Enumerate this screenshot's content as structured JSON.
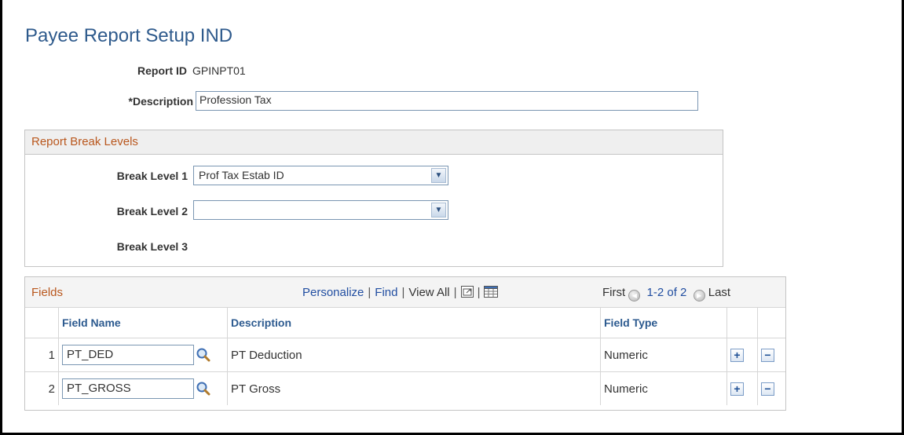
{
  "page": {
    "title": "Payee Report Setup IND"
  },
  "report": {
    "id_label": "Report ID",
    "id_value": "GPINPT01",
    "description_label": "*Description",
    "description_value": "Profession Tax"
  },
  "break_levels": {
    "title": "Report Break Levels",
    "level1_label": "Break Level 1",
    "level1_value": "Prof Tax Estab ID",
    "level2_label": "Break Level 2",
    "level2_value": "",
    "level3_label": "Break Level 3"
  },
  "fields_grid": {
    "title": "Fields",
    "nav": {
      "personalize": "Personalize",
      "find": "Find",
      "view_all": "View All",
      "sep": "|",
      "first": "First",
      "count": "1-2 of 2",
      "last": "Last"
    },
    "columns": {
      "field_name": "Field Name",
      "description": "Description",
      "field_type": "Field Type"
    },
    "rows": [
      {
        "num": "1",
        "field_name": "PT_DED",
        "description": "PT Deduction",
        "field_type": "Numeric"
      },
      {
        "num": "2",
        "field_name": "PT_GROSS",
        "description": "PT Gross",
        "field_type": "Numeric"
      }
    ],
    "add_symbol": "+",
    "delete_symbol": "−"
  },
  "icons": {
    "lookup": "magnifier-icon",
    "zoom": "new-window-icon",
    "download": "spreadsheet-icon",
    "prev": "left-arrow-icon",
    "next": "right-arrow-icon"
  },
  "colors": {
    "title_blue": "#2e5a8c",
    "section_orange": "#b9571d",
    "link_blue": "#214ea1"
  }
}
